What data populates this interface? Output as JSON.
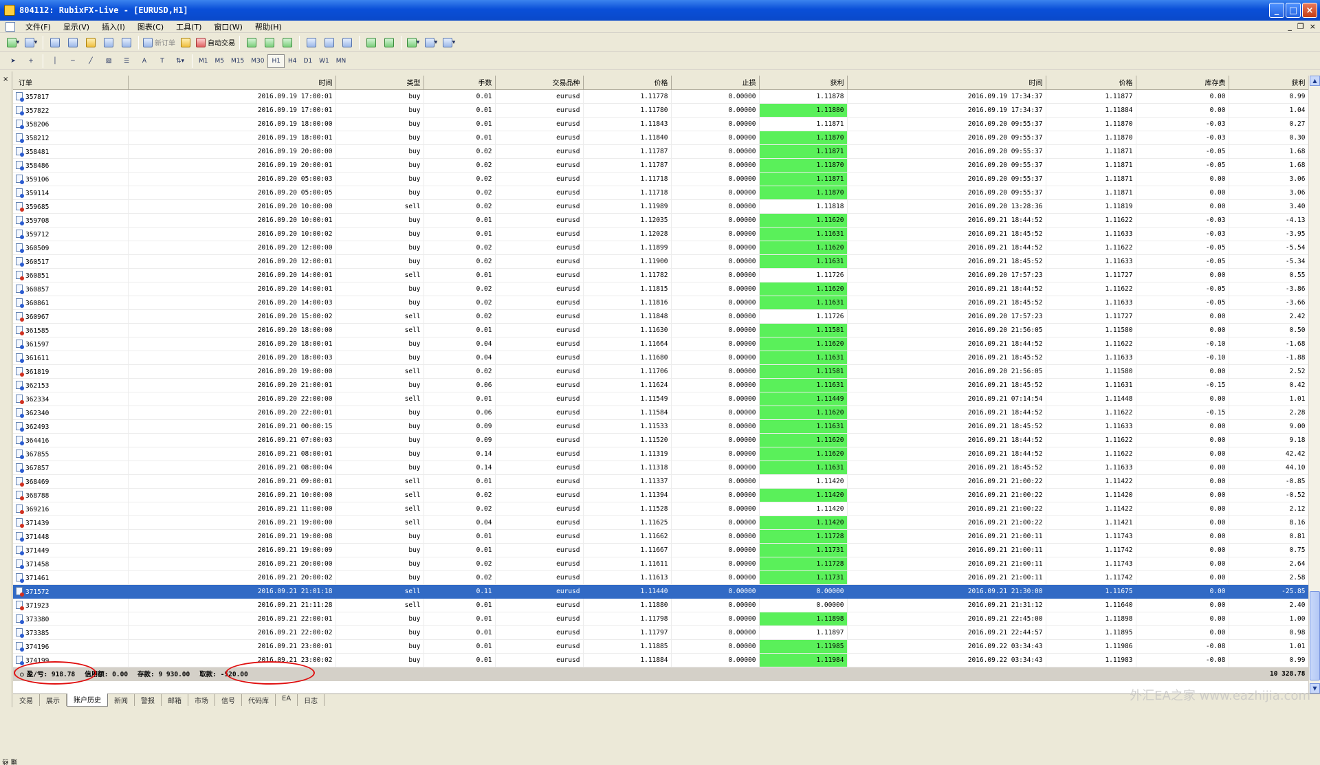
{
  "window": {
    "title": "804112: RubixFX-Live - [EURUSD,H1]"
  },
  "menu": [
    "文件(F)",
    "显示(V)",
    "插入(I)",
    "图表(C)",
    "工具(T)",
    "窗口(W)",
    "帮助(H)"
  ],
  "toolbar": {
    "new_order": "新订单",
    "auto_trading": "自动交易"
  },
  "timeframes": [
    "M1",
    "M5",
    "M15",
    "M30",
    "H1",
    "H4",
    "D1",
    "W1",
    "MN"
  ],
  "active_timeframe": "H1",
  "columns": [
    "订单",
    "时间",
    "类型",
    "手数",
    "交易品种",
    "价格",
    "止损",
    "获利",
    "时间",
    "价格",
    "库存费",
    "获利"
  ],
  "rows": [
    [
      "357817",
      "2016.09.19 17:00:01",
      "buy",
      "0.01",
      "eurusd",
      "1.11778",
      "0.00000",
      "1.11878",
      "2016.09.19 17:34:37",
      "1.11877",
      "0.00",
      "0.99"
    ],
    [
      "357822",
      "2016.09.19 17:00:01",
      "buy",
      "0.01",
      "eurusd",
      "1.11780",
      "0.00000",
      "1.11880",
      "2016.09.19 17:34:37",
      "1.11884",
      "0.00",
      "1.04"
    ],
    [
      "358206",
      "2016.09.19 18:00:00",
      "buy",
      "0.01",
      "eurusd",
      "1.11843",
      "0.00000",
      "1.11871",
      "2016.09.20 09:55:37",
      "1.11870",
      "-0.03",
      "0.27"
    ],
    [
      "358212",
      "2016.09.19 18:00:01",
      "buy",
      "0.01",
      "eurusd",
      "1.11840",
      "0.00000",
      "1.11870",
      "2016.09.20 09:55:37",
      "1.11870",
      "-0.03",
      "0.30"
    ],
    [
      "358481",
      "2016.09.19 20:00:00",
      "buy",
      "0.02",
      "eurusd",
      "1.11787",
      "0.00000",
      "1.11871",
      "2016.09.20 09:55:37",
      "1.11871",
      "-0.05",
      "1.68"
    ],
    [
      "358486",
      "2016.09.19 20:00:01",
      "buy",
      "0.02",
      "eurusd",
      "1.11787",
      "0.00000",
      "1.11870",
      "2016.09.20 09:55:37",
      "1.11871",
      "-0.05",
      "1.68"
    ],
    [
      "359106",
      "2016.09.20 05:00:03",
      "buy",
      "0.02",
      "eurusd",
      "1.11718",
      "0.00000",
      "1.11871",
      "2016.09.20 09:55:37",
      "1.11871",
      "0.00",
      "3.06"
    ],
    [
      "359114",
      "2016.09.20 05:00:05",
      "buy",
      "0.02",
      "eurusd",
      "1.11718",
      "0.00000",
      "1.11870",
      "2016.09.20 09:55:37",
      "1.11871",
      "0.00",
      "3.06"
    ],
    [
      "359685",
      "2016.09.20 10:00:00",
      "sell",
      "0.02",
      "eurusd",
      "1.11989",
      "0.00000",
      "1.11818",
      "2016.09.20 13:28:36",
      "1.11819",
      "0.00",
      "3.40"
    ],
    [
      "359708",
      "2016.09.20 10:00:01",
      "buy",
      "0.01",
      "eurusd",
      "1.12035",
      "0.00000",
      "1.11620",
      "2016.09.21 18:44:52",
      "1.11622",
      "-0.03",
      "-4.13"
    ],
    [
      "359712",
      "2016.09.20 10:00:02",
      "buy",
      "0.01",
      "eurusd",
      "1.12028",
      "0.00000",
      "1.11631",
      "2016.09.21 18:45:52",
      "1.11633",
      "-0.03",
      "-3.95"
    ],
    [
      "360509",
      "2016.09.20 12:00:00",
      "buy",
      "0.02",
      "eurusd",
      "1.11899",
      "0.00000",
      "1.11620",
      "2016.09.21 18:44:52",
      "1.11622",
      "-0.05",
      "-5.54"
    ],
    [
      "360517",
      "2016.09.20 12:00:01",
      "buy",
      "0.02",
      "eurusd",
      "1.11900",
      "0.00000",
      "1.11631",
      "2016.09.21 18:45:52",
      "1.11633",
      "-0.05",
      "-5.34"
    ],
    [
      "360851",
      "2016.09.20 14:00:01",
      "sell",
      "0.01",
      "eurusd",
      "1.11782",
      "0.00000",
      "1.11726",
      "2016.09.20 17:57:23",
      "1.11727",
      "0.00",
      "0.55"
    ],
    [
      "360857",
      "2016.09.20 14:00:01",
      "buy",
      "0.02",
      "eurusd",
      "1.11815",
      "0.00000",
      "1.11620",
      "2016.09.21 18:44:52",
      "1.11622",
      "-0.05",
      "-3.86"
    ],
    [
      "360861",
      "2016.09.20 14:00:03",
      "buy",
      "0.02",
      "eurusd",
      "1.11816",
      "0.00000",
      "1.11631",
      "2016.09.21 18:45:52",
      "1.11633",
      "-0.05",
      "-3.66"
    ],
    [
      "360967",
      "2016.09.20 15:00:02",
      "sell",
      "0.02",
      "eurusd",
      "1.11848",
      "0.00000",
      "1.11726",
      "2016.09.20 17:57:23",
      "1.11727",
      "0.00",
      "2.42"
    ],
    [
      "361585",
      "2016.09.20 18:00:00",
      "sell",
      "0.01",
      "eurusd",
      "1.11630",
      "0.00000",
      "1.11581",
      "2016.09.20 21:56:05",
      "1.11580",
      "0.00",
      "0.50"
    ],
    [
      "361597",
      "2016.09.20 18:00:01",
      "buy",
      "0.04",
      "eurusd",
      "1.11664",
      "0.00000",
      "1.11620",
      "2016.09.21 18:44:52",
      "1.11622",
      "-0.10",
      "-1.68"
    ],
    [
      "361611",
      "2016.09.20 18:00:03",
      "buy",
      "0.04",
      "eurusd",
      "1.11680",
      "0.00000",
      "1.11631",
      "2016.09.21 18:45:52",
      "1.11633",
      "-0.10",
      "-1.88"
    ],
    [
      "361819",
      "2016.09.20 19:00:00",
      "sell",
      "0.02",
      "eurusd",
      "1.11706",
      "0.00000",
      "1.11581",
      "2016.09.20 21:56:05",
      "1.11580",
      "0.00",
      "2.52"
    ],
    [
      "362153",
      "2016.09.20 21:00:01",
      "buy",
      "0.06",
      "eurusd",
      "1.11624",
      "0.00000",
      "1.11631",
      "2016.09.21 18:45:52",
      "1.11631",
      "-0.15",
      "0.42"
    ],
    [
      "362334",
      "2016.09.20 22:00:00",
      "sell",
      "0.01",
      "eurusd",
      "1.11549",
      "0.00000",
      "1.11449",
      "2016.09.21 07:14:54",
      "1.11448",
      "0.00",
      "1.01"
    ],
    [
      "362340",
      "2016.09.20 22:00:01",
      "buy",
      "0.06",
      "eurusd",
      "1.11584",
      "0.00000",
      "1.11620",
      "2016.09.21 18:44:52",
      "1.11622",
      "-0.15",
      "2.28"
    ],
    [
      "362493",
      "2016.09.21 00:00:15",
      "buy",
      "0.09",
      "eurusd",
      "1.11533",
      "0.00000",
      "1.11631",
      "2016.09.21 18:45:52",
      "1.11633",
      "0.00",
      "9.00"
    ],
    [
      "364416",
      "2016.09.21 07:00:03",
      "buy",
      "0.09",
      "eurusd",
      "1.11520",
      "0.00000",
      "1.11620",
      "2016.09.21 18:44:52",
      "1.11622",
      "0.00",
      "9.18"
    ],
    [
      "367855",
      "2016.09.21 08:00:01",
      "buy",
      "0.14",
      "eurusd",
      "1.11319",
      "0.00000",
      "1.11620",
      "2016.09.21 18:44:52",
      "1.11622",
      "0.00",
      "42.42"
    ],
    [
      "367857",
      "2016.09.21 08:00:04",
      "buy",
      "0.14",
      "eurusd",
      "1.11318",
      "0.00000",
      "1.11631",
      "2016.09.21 18:45:52",
      "1.11633",
      "0.00",
      "44.10"
    ],
    [
      "368469",
      "2016.09.21 09:00:01",
      "sell",
      "0.01",
      "eurusd",
      "1.11337",
      "0.00000",
      "1.11420",
      "2016.09.21 21:00:22",
      "1.11422",
      "0.00",
      "-0.85"
    ],
    [
      "368788",
      "2016.09.21 10:00:00",
      "sell",
      "0.02",
      "eurusd",
      "1.11394",
      "0.00000",
      "1.11420",
      "2016.09.21 21:00:22",
      "1.11420",
      "0.00",
      "-0.52"
    ],
    [
      "369216",
      "2016.09.21 11:00:00",
      "sell",
      "0.02",
      "eurusd",
      "1.11528",
      "0.00000",
      "1.11420",
      "2016.09.21 21:00:22",
      "1.11422",
      "0.00",
      "2.12"
    ],
    [
      "371439",
      "2016.09.21 19:00:00",
      "sell",
      "0.04",
      "eurusd",
      "1.11625",
      "0.00000",
      "1.11420",
      "2016.09.21 21:00:22",
      "1.11421",
      "0.00",
      "8.16"
    ],
    [
      "371448",
      "2016.09.21 19:00:08",
      "buy",
      "0.01",
      "eurusd",
      "1.11662",
      "0.00000",
      "1.11728",
      "2016.09.21 21:00:11",
      "1.11743",
      "0.00",
      "0.81"
    ],
    [
      "371449",
      "2016.09.21 19:00:09",
      "buy",
      "0.01",
      "eurusd",
      "1.11667",
      "0.00000",
      "1.11731",
      "2016.09.21 21:00:11",
      "1.11742",
      "0.00",
      "0.75"
    ],
    [
      "371458",
      "2016.09.21 20:00:00",
      "buy",
      "0.02",
      "eurusd",
      "1.11611",
      "0.00000",
      "1.11728",
      "2016.09.21 21:00:11",
      "1.11743",
      "0.00",
      "2.64"
    ],
    [
      "371461",
      "2016.09.21 20:00:02",
      "buy",
      "0.02",
      "eurusd",
      "1.11613",
      "0.00000",
      "1.11731",
      "2016.09.21 21:00:11",
      "1.11742",
      "0.00",
      "2.58"
    ],
    [
      "371572",
      "2016.09.21 21:01:18",
      "sell",
      "0.11",
      "eurusd",
      "1.11440",
      "0.00000",
      "0.00000",
      "2016.09.21 21:30:00",
      "1.11675",
      "0.00",
      "-25.85"
    ],
    [
      "371923",
      "2016.09.21 21:11:28",
      "sell",
      "0.01",
      "eurusd",
      "1.11880",
      "0.00000",
      "0.00000",
      "2016.09.21 21:31:12",
      "1.11640",
      "0.00",
      "2.40"
    ],
    [
      "373380",
      "2016.09.21 22:00:01",
      "buy",
      "0.01",
      "eurusd",
      "1.11798",
      "0.00000",
      "1.11898",
      "2016.09.21 22:45:00",
      "1.11898",
      "0.00",
      "1.00"
    ],
    [
      "373385",
      "2016.09.21 22:00:02",
      "buy",
      "0.01",
      "eurusd",
      "1.11797",
      "0.00000",
      "1.11897",
      "2016.09.21 22:44:57",
      "1.11895",
      "0.00",
      "0.98"
    ],
    [
      "374196",
      "2016.09.21 23:00:01",
      "buy",
      "0.01",
      "eurusd",
      "1.11885",
      "0.00000",
      "1.11985",
      "2016.09.22 03:34:43",
      "1.11986",
      "-0.08",
      "1.01"
    ],
    [
      "374199",
      "2016.09.21 23:00:02",
      "buy",
      "0.01",
      "eurusd",
      "1.11884",
      "0.00000",
      "1.11984",
      "2016.09.22 03:34:43",
      "1.11983",
      "-0.08",
      "0.99"
    ]
  ],
  "tp_highlight": [
    false,
    true,
    false,
    true,
    true,
    true,
    true,
    true,
    false,
    true,
    true,
    true,
    true,
    false,
    true,
    true,
    false,
    true,
    true,
    true,
    true,
    true,
    true,
    true,
    true,
    true,
    true,
    true,
    false,
    true,
    false,
    true,
    true,
    true,
    true,
    true,
    false,
    false,
    true,
    false,
    true,
    true
  ],
  "selected_row": 36,
  "summary": {
    "profit_loss": "盈/亏: 918.78",
    "credit": "信用额: 0.00",
    "deposit": "存款: 9 930.00",
    "withdrawal": "取款: -520.00",
    "total": "10 328.78"
  },
  "tabs": [
    "交易",
    "展示",
    "账户历史",
    "新闻",
    "警报",
    "邮箱",
    "市场",
    "信号",
    "代码库",
    "EA",
    "日志"
  ],
  "active_tab": "账户历史",
  "sidebar_label": "终端",
  "watermark": "外汇EA之家 www.eazhijia.com",
  "colors": {
    "tp_highlight": "#5af05a",
    "selected_row": "#316ac5",
    "annotation_circle": "#e01010"
  }
}
